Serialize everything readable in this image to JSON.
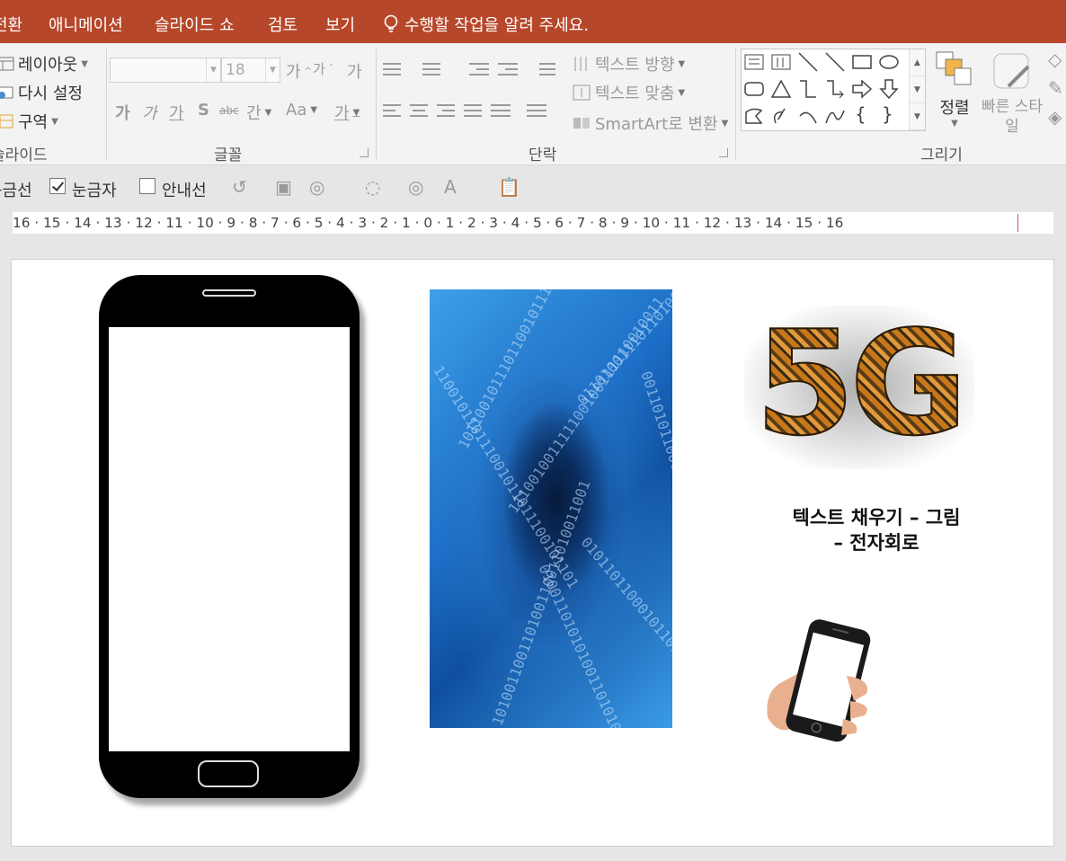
{
  "tabs": {
    "transitions": "전환",
    "animations": "애니메이션",
    "slideshow": "슬라이드 쇼",
    "review": "검토",
    "view": "보기",
    "tell_me": "수행할 작업을 알려 주세요."
  },
  "ribbon": {
    "slides": {
      "layout": "레이아웃",
      "reset": "다시 설정",
      "section": "구역",
      "label": "슬라이드"
    },
    "font": {
      "size": "18",
      "grow": "가",
      "shrink": "가",
      "clear": "가",
      "bold": "가",
      "italic": "가",
      "underline": "가",
      "shadow": "S",
      "strike": "abc",
      "spacing": "간",
      "case": "Aa",
      "color": "가",
      "label": "글꼴"
    },
    "paragraph": {
      "text_direction": "텍스트 방향",
      "align_text": "텍스트 맞춤",
      "smartart": "SmartArt로 변환",
      "label": "단락"
    },
    "drawing": {
      "arrange": "정렬",
      "quick_styles": "빠른 스타일",
      "label": "그리기"
    }
  },
  "viewbar": {
    "gridlines": "눈금선",
    "ruler": "눈금자",
    "guides": "안내선",
    "ruler_checked": true,
    "guides_checked": false
  },
  "ruler_text": "16 · 15 · 14 · 13 · 12 · 11 · 10 · 9 · 8 · 7 · 6 · 5 · 4 · 3 · 2 · 1 · 0 · 1 · 2 · 3 · 4 · 5 · 6 · 7 · 8 · 9 · 10 · 11 · 12 · 13 · 14 · 15 · 16",
  "slide": {
    "fiveg_text": "5G",
    "caption_line1": "텍스트 채우기 – 그림",
    "caption_line2": "– 전자회로",
    "binary_rows": [
      "1011001011",
      "0110100111",
      "1100101101",
      "0011010110",
      "1010011001",
      "0101101100",
      "1110010011",
      "0100110101"
    ]
  },
  "colors": {
    "accent": "#b7472a",
    "ribbon_bg": "#f3f3f3",
    "canvas_bg": "#e6e6e6"
  }
}
